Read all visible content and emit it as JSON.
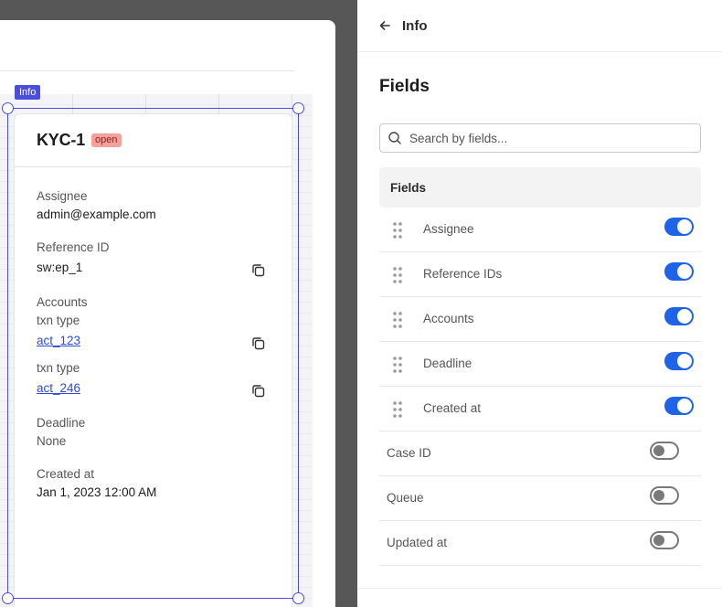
{
  "canvas": {
    "selection_tag": "Info",
    "card": {
      "title": "KYC-1",
      "status": "open",
      "fields": {
        "assignee_label": "Assignee",
        "assignee_value": "admin@example.com",
        "reference_label": "Reference ID",
        "reference_value": "sw:ep_1",
        "accounts_label": "Accounts",
        "accounts": [
          {
            "type": "txn type",
            "id": "act_123"
          },
          {
            "type": "txn type",
            "id": "act_246"
          }
        ],
        "deadline_label": "Deadline",
        "deadline_value": "None",
        "created_label": "Created at",
        "created_value": "Jan 1, 2023 12:00 AM"
      }
    }
  },
  "panel": {
    "title": "Info",
    "section_title": "Fields",
    "search_placeholder": "Search by fields...",
    "list_header": "Fields",
    "rows": [
      {
        "label": "Assignee",
        "enabled": true,
        "draggable": true
      },
      {
        "label": "Reference IDs",
        "enabled": true,
        "draggable": true
      },
      {
        "label": "Accounts",
        "enabled": true,
        "draggable": true
      },
      {
        "label": "Deadline",
        "enabled": true,
        "draggable": true
      },
      {
        "label": "Created at",
        "enabled": true,
        "draggable": true
      },
      {
        "label": "Case ID",
        "enabled": false,
        "draggable": false
      },
      {
        "label": "Queue",
        "enabled": false,
        "draggable": false
      },
      {
        "label": "Updated at",
        "enabled": false,
        "draggable": false
      }
    ]
  },
  "colors": {
    "accent": "#1f63e8",
    "selection": "#4a4ee0",
    "badge_bg": "#f4a09b",
    "link": "#2f4bd9"
  }
}
